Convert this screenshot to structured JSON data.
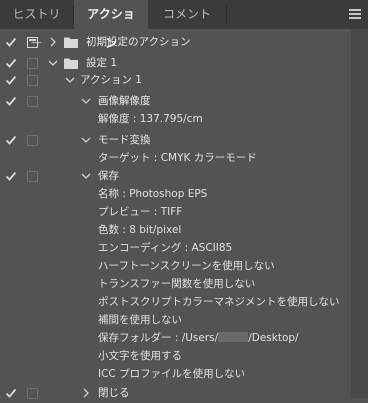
{
  "tabs": [
    {
      "label": "ヒストリー"
    },
    {
      "label": "アクション"
    },
    {
      "label": "コメント"
    }
  ],
  "action_panel": {
    "set_default": {
      "label": "初期設定のアクション"
    },
    "set1": {
      "label": "設定 1"
    },
    "action1": {
      "label": "アクション 1"
    },
    "step_resolution": {
      "label": "画像解像度",
      "params": [
        "解像度 : 137.795/cm"
      ]
    },
    "step_mode": {
      "label": "モード変換",
      "params": [
        "ターゲット : CMYK カラーモード"
      ]
    },
    "step_save": {
      "label": "保存",
      "params": [
        "名称 : Photoshop EPS",
        "プレビュー : TIFF",
        "色数 : 8 bit/pixel",
        "エンコーディング : ASCII85",
        "ハーフトーンスクリーンを使用しない",
        "トランスファー関数を使用しない",
        "ポストスクリプトカラーマネジメントを使用しない",
        "補間を使用しない",
        "保存フォルダー : /Users/",
        "/Desktop/",
        "小文字を使用する",
        "ICC プロファイルを使用しない"
      ]
    },
    "step_close": {
      "label": "閉じる"
    }
  },
  "colors": {
    "panel_bg": "#535353",
    "tab_bar": "#3b3b3b",
    "text": "#e6e6e6"
  },
  "icons": [
    "check-icon",
    "folder-icon",
    "chevron-right-icon",
    "chevron-down-icon",
    "dialog-toggle-icon",
    "panel-menu-icon"
  ]
}
